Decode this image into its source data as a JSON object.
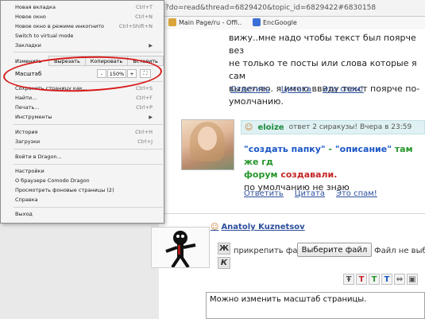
{
  "browser": {
    "url_fragment": "?do=read&thread=6829420&topic_id=6829422#6830158",
    "bookmarks": [
      {
        "label": "Main Page/ru - Offi..",
        "color": "#d9a43a"
      },
      {
        "label": "EncGoogle",
        "color": "#3b6fd6"
      }
    ]
  },
  "menu": {
    "items_top": [
      {
        "label": "Новая вкладка",
        "shortcut": "Ctrl+T"
      },
      {
        "label": "Новое окно",
        "shortcut": "Ctrl+N"
      },
      {
        "label": "Новое окно в режиме инкогнито",
        "shortcut": "Ctrl+Shift+N"
      },
      {
        "label": "Switch to virtual mode",
        "shortcut": ""
      },
      {
        "label": "Закладки",
        "shortcut": ""
      }
    ],
    "edit": {
      "label": "Изменить",
      "cut": "Вырезать",
      "copy": "Копировать",
      "paste": "Вставить"
    },
    "zoom": {
      "label": "Масштаб",
      "minus": "-",
      "value": "150%",
      "plus": "+",
      "fullscreen": "⛶"
    },
    "items_mid": [
      {
        "label": "Сохранить страницу как...",
        "shortcut": "Ctrl+S"
      },
      {
        "label": "Найти...",
        "shortcut": "Ctrl+F"
      },
      {
        "label": "Печать...",
        "shortcut": "Ctrl+P"
      },
      {
        "label": "Инструменты",
        "shortcut": ""
      }
    ],
    "items_history": [
      {
        "label": "История",
        "shortcut": "Ctrl+H"
      },
      {
        "label": "Загрузки",
        "shortcut": "Ctrl+J"
      }
    ],
    "signin": "Войти в Dragon...",
    "items_settings": [
      {
        "label": "Настройки"
      },
      {
        "label": "О браузере Comodo Dragon"
      },
      {
        "label": "Просмотреть фоновые страницы (2)"
      },
      {
        "label": "Справка"
      }
    ],
    "exit": "Выход"
  },
  "post1": {
    "lines": [
      "вижу..мне надо чтобы текст был поярче вез",
      "не только те посты или слова которые я сам",
      "выделяю. я имею ввиду текст поярче по-",
      "умолчанию."
    ],
    "reply": "Ответить",
    "quote": "Цитата",
    "spam": "Это спам!"
  },
  "post2": {
    "user": "eloize",
    "meta": "ответ 2 сиракузы!  Вчера в 23:59",
    "line1_a": "\"создать папку\"",
    "line1_b": " - ",
    "line1_c": "\"описание\"",
    "line1_d": " там же гд",
    "line2_a": "форум ",
    "line2_b": "создавали.",
    "line3": "по умолчанию не знаю",
    "reply": "Ответить",
    "quote": "Цитата",
    "spam": "Это спам!"
  },
  "reply_form": {
    "user": "Anatoly Kuznetsov",
    "bold_btn": "Ж",
    "italic_btn": "К",
    "attach_label": "прикрепить файл:",
    "file_button": "Выберите файл",
    "file_status": "Файл не выб",
    "toolbar": [
      "Ŧ",
      "T",
      "T",
      "T",
      "⇔"
    ],
    "toolbar_colors": [
      "#555555",
      "#c62727",
      "#26962b",
      "#1a56c6",
      "#555555"
    ],
    "textarea_value": "Можно изменить масштаб страницы."
  }
}
